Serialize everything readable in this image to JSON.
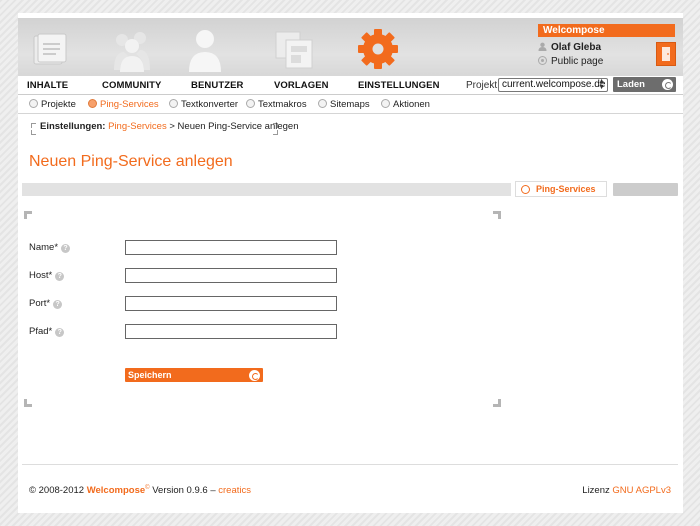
{
  "header": {
    "brand": "Welcompose",
    "user_name": "Olaf Gleba",
    "public_page": "Public page",
    "icons": [
      "content-icon",
      "community-icon",
      "user-icon",
      "templates-icon",
      "settings-gear-icon"
    ]
  },
  "mainnav": {
    "items": [
      "INHALTE",
      "COMMUNITY",
      "BENUTZER",
      "VORLAGEN",
      "EINSTELLUNGEN"
    ],
    "projekt_label": "Projekt:",
    "projekt_value": "current.welcompose.de",
    "laden_label": "Laden"
  },
  "subnav": {
    "items": [
      "Projekte",
      "Ping-Services",
      "Textkonverter",
      "Textmakros",
      "Sitemaps",
      "Aktionen"
    ],
    "active": "Ping-Services"
  },
  "breadcrumb": {
    "section": "Einstellungen:",
    "link": "Ping-Services",
    "separator": ">",
    "current": "Neuen Ping-Service anlegen"
  },
  "page_title": "Neuen Ping-Service anlegen",
  "toolbar": {
    "ping_services_link": "Ping-Services"
  },
  "form": {
    "fields": [
      {
        "label": "Name*",
        "value": ""
      },
      {
        "label": "Host*",
        "value": ""
      },
      {
        "label": "Port*",
        "value": ""
      },
      {
        "label": "Pfad*",
        "value": ""
      }
    ],
    "help_glyph": "?",
    "save_label": "Speichern"
  },
  "footer": {
    "copyright": "© 2008-2012",
    "brand": "Welcompose",
    "brand_sup": "©",
    "version": "Version 0.9.6 –",
    "creatics": "creatics",
    "license_label": "Lizenz",
    "license": "GNU AGPLv3"
  },
  "colors": {
    "accent": "#f26b1d",
    "grey_button": "#6d6d6d"
  }
}
